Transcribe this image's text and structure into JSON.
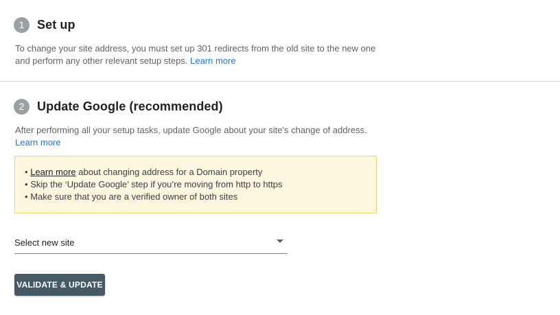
{
  "step1": {
    "number": "1",
    "title": "Set up",
    "description": "To change your site address, you must set up 301 redirects from the old site to the new one and perform any other relevant setup steps.",
    "learn_more": "Learn more"
  },
  "step2": {
    "number": "2",
    "title": "Update Google (recommended)",
    "description": "After performing all your setup tasks, update Google about your site's change of address.",
    "learn_more": "Learn more"
  },
  "notice": {
    "bullet": "•",
    "item1_link": "Learn more",
    "item1_text": " about changing address for a Domain property",
    "item2_text": "Skip the ‘Update Google’ step if you’re moving from http to https",
    "item3_text": "Make sure that you are a verified owner of both sites"
  },
  "site_select": {
    "label": "Select new site",
    "icon": "dropdown-caret-icon"
  },
  "validate_button": {
    "label": "VALIDATE & UPDATE"
  },
  "colors": {
    "link": "#1a73e8",
    "notice_bg": "#fef7e0",
    "notice_border": "#f6d36b",
    "button_bg": "#455a64",
    "step_circle": "#9aa0a6"
  }
}
